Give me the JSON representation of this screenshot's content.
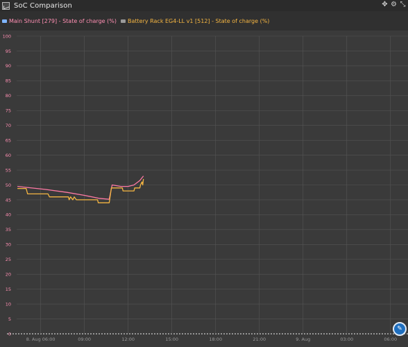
{
  "window": {
    "title": "SoC Comparison",
    "controls": [
      "move-icon",
      "gear-icon",
      "collapse-icon"
    ]
  },
  "legend": [
    {
      "label": "Main Shunt [279] - State of charge (%)",
      "color": "#ff7aa5"
    },
    {
      "label": "Battery Rack EG4-LL v1 [512] - State of charge (%)",
      "color": "#f6b642"
    }
  ],
  "colors": {
    "background": "#3a3a3a",
    "grid": "#555555",
    "y_tick_text": "#ff8fb3",
    "x_tick_text": "#999999",
    "series1": "#ff7aa5",
    "series2": "#f6b642"
  },
  "chart_data": {
    "type": "line",
    "ylim": [
      0,
      100
    ],
    "y_ticks": [
      "0",
      "5",
      "10",
      "15",
      "20",
      "25",
      "30",
      "35",
      "40",
      "45",
      "50",
      "55",
      "60",
      "65",
      "70",
      "75",
      "80",
      "85",
      "90",
      "95",
      "100"
    ],
    "x_ticks": [
      "8. Aug 06:00",
      "09:00",
      "12:00",
      "15:00",
      "18:00",
      "21:00",
      "9. Aug",
      "03:00",
      "06:00"
    ],
    "x_tick_hours": [
      6,
      9,
      12,
      15,
      18,
      21,
      24,
      27,
      30
    ],
    "xlim_hours": [
      4.35,
      31.2
    ],
    "grid": true,
    "series": [
      {
        "name": "Main Shunt [279] - State of charge (%)",
        "points": [
          [
            4.4,
            49.5
          ],
          [
            6.3,
            48.5
          ],
          [
            7.8,
            47.5
          ],
          [
            9.0,
            46.5
          ],
          [
            10.0,
            45.5
          ],
          [
            10.7,
            45.2
          ],
          [
            10.9,
            50
          ],
          [
            11.5,
            49.5
          ],
          [
            12.0,
            49.5
          ],
          [
            12.4,
            50
          ],
          [
            12.8,
            51.5
          ],
          [
            13.05,
            53
          ]
        ]
      },
      {
        "name": "Battery Rack EG4-LL v1 [512] - State of charge (%)",
        "points": [
          [
            4.4,
            48.8
          ],
          [
            5.0,
            48.8
          ],
          [
            5.1,
            47
          ],
          [
            6.5,
            47
          ],
          [
            6.6,
            46
          ],
          [
            7.9,
            46
          ],
          [
            7.95,
            45
          ],
          [
            8.05,
            46
          ],
          [
            8.2,
            45
          ],
          [
            8.3,
            46
          ],
          [
            8.45,
            45
          ],
          [
            9.9,
            45
          ],
          [
            9.95,
            44
          ],
          [
            10.7,
            44
          ],
          [
            10.85,
            49
          ],
          [
            11.6,
            49
          ],
          [
            11.65,
            48
          ],
          [
            12.4,
            48
          ],
          [
            12.45,
            49
          ],
          [
            12.8,
            49
          ],
          [
            12.85,
            50
          ],
          [
            12.95,
            51
          ],
          [
            13.0,
            50
          ],
          [
            13.05,
            52
          ]
        ]
      }
    ]
  }
}
